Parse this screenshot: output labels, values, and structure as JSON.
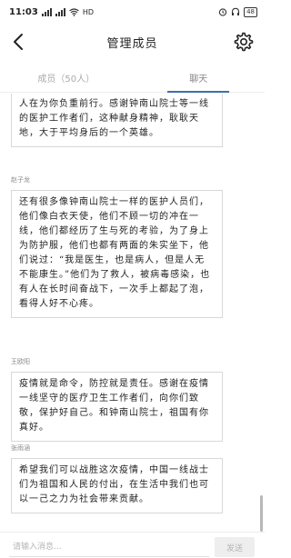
{
  "status_bar": {
    "time": "11:03",
    "network": "HD",
    "battery": "48"
  },
  "nav": {
    "title": "管理成员"
  },
  "tabs": [
    {
      "label": "成员（50人）",
      "active": false
    },
    {
      "label": "聊天",
      "active": true
    }
  ],
  "messages": [
    {
      "name": "",
      "text": "人在为你负重前行。感谢钟南山院士等一线的医护工作者们，这种献身精神，耿耿天地，大于平均身后的一个英雄。"
    },
    {
      "name": "赵子龙",
      "text": "还有很多像钟南山院士一样的医护人员们，他们像白衣天使，他们不顾一切的冲在一线，他们都经历了生与死的考验，为了身上为防护服，他们也都有两面的朱实坐下，他们说过：“我是医生，也是病人，但是人无不能康生。”他们为了救人，被病毒感染，也有人在长时间奋战下，一次手上都起了泡，看得人好不心疼。"
    },
    {
      "name": "王欧阳",
      "text": "疫情就是命令，防控就是责任。感谢在疫情一线坚守的医疗卫生工作者们，向你们致敬，保护好自己。和钟南山院士，祖国有你真好。"
    },
    {
      "name": "张雨涵",
      "text": "希望我们可以战胜这次疫情，中国一线战士们为祖国和人民的付出，在生活中我们也可以一己之力为社会带来贡献。"
    }
  ],
  "input": {
    "placeholder": "请输入消息...",
    "value": "",
    "send_label": "发送"
  },
  "colors": {
    "accent": "#3a6fb0",
    "bubble_border": "#d8d8d8",
    "send_button_bg": "#eeeeee"
  }
}
